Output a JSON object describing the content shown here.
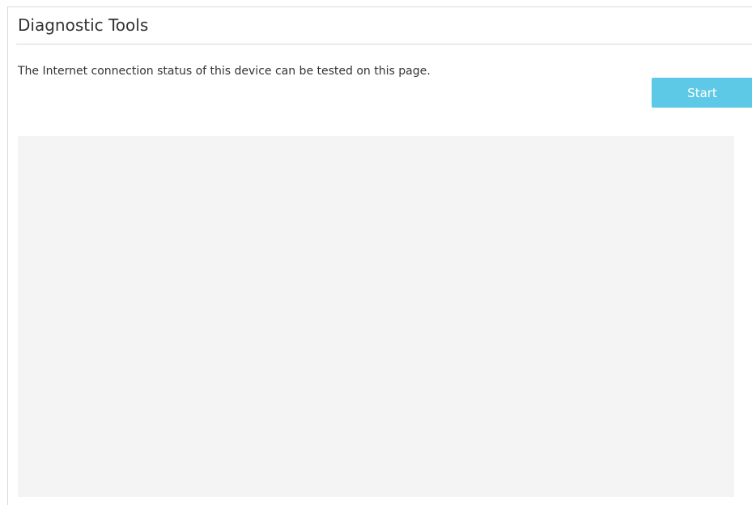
{
  "panel": {
    "title": "Diagnostic Tools",
    "description": "The Internet connection status of this device can be tested on this page.",
    "start_label": "Start",
    "output_text": ""
  },
  "colors": {
    "accent": "#5ec9e6",
    "output_background": "#f4f4f4",
    "divider": "#d9d9d9",
    "text": "#333333"
  }
}
